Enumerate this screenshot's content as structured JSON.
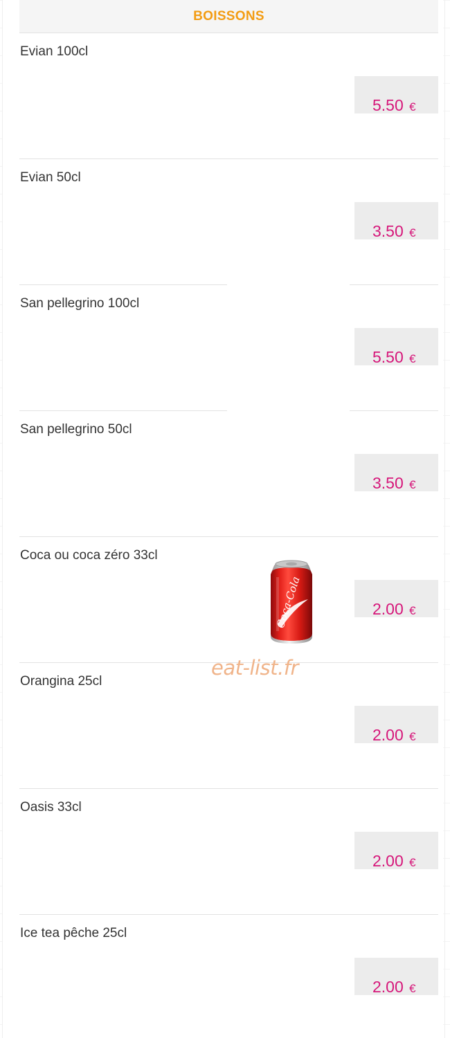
{
  "section": {
    "title": "BOISSONS"
  },
  "items": [
    {
      "name": "Evian 100cl",
      "price": "5.50",
      "currency": "€"
    },
    {
      "name": "Evian 50cl",
      "price": "3.50",
      "currency": "€"
    },
    {
      "name": "San pellegrino 100cl",
      "price": "5.50",
      "currency": "€"
    },
    {
      "name": "San pellegrino 50cl",
      "price": "3.50",
      "currency": "€"
    },
    {
      "name": "Coca ou coca zéro 33cl",
      "price": "2.00",
      "currency": "€"
    },
    {
      "name": "Orangina 25cl",
      "price": "2.00",
      "currency": "€"
    },
    {
      "name": "Oasis 33cl",
      "price": "2.00",
      "currency": "€"
    },
    {
      "name": "Ice tea pêche 25cl",
      "price": "2.00",
      "currency": "€"
    }
  ],
  "watermark": "eat-list.fr",
  "product_image": {
    "icon": "coca-cola-can-icon",
    "label": "Coca-Cola"
  },
  "colors": {
    "title": "#f39c12",
    "price": "#d6177a",
    "price_bg": "#ececec",
    "divider": "#e2e2e2"
  }
}
